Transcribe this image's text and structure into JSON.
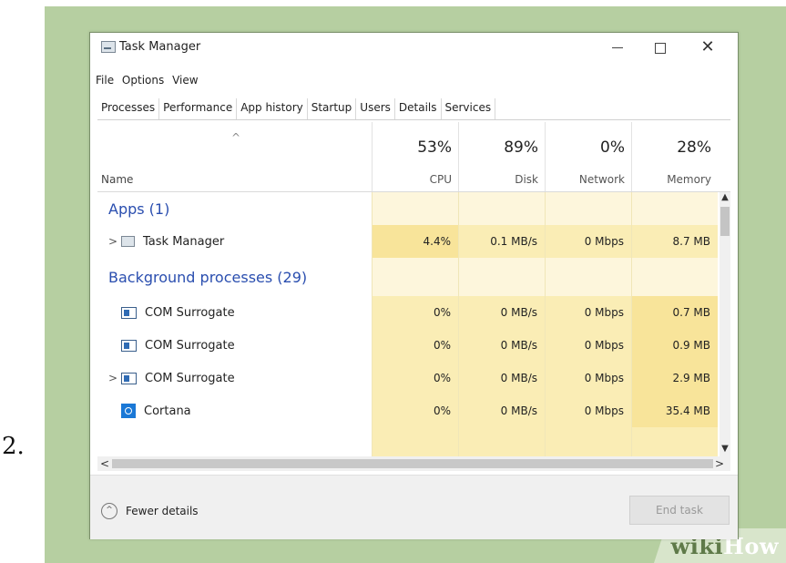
{
  "step_label": "2.",
  "watermark": {
    "wiki": "wiki",
    "how": "How"
  },
  "window": {
    "title": "Task Manager"
  },
  "menu": [
    "File",
    "Options",
    "View"
  ],
  "tabs": [
    "Processes",
    "Performance",
    "App history",
    "Startup",
    "Users",
    "Details",
    "Services"
  ],
  "header": {
    "name_label": "Name",
    "columns": [
      {
        "pct": "53%",
        "label": "CPU"
      },
      {
        "pct": "89%",
        "label": "Disk"
      },
      {
        "pct": "0%",
        "label": "Network"
      },
      {
        "pct": "28%",
        "label": "Memory"
      }
    ]
  },
  "groups": [
    {
      "label": "Apps (1)"
    },
    {
      "label": "Background processes (29)"
    }
  ],
  "rows": [
    {
      "name": "Task Manager",
      "cpu": "4.4%",
      "disk": "0.1 MB/s",
      "network": "0 Mbps",
      "memory": "8.7 MB"
    },
    {
      "name": "COM Surrogate",
      "cpu": "0%",
      "disk": "0 MB/s",
      "network": "0 Mbps",
      "memory": "0.7 MB"
    },
    {
      "name": "COM Surrogate",
      "cpu": "0%",
      "disk": "0 MB/s",
      "network": "0 Mbps",
      "memory": "0.9 MB"
    },
    {
      "name": "COM Surrogate",
      "cpu": "0%",
      "disk": "0 MB/s",
      "network": "0 Mbps",
      "memory": "2.9 MB"
    },
    {
      "name": "Cortana",
      "cpu": "0%",
      "disk": "0 MB/s",
      "network": "0 Mbps",
      "memory": "35.4 MB"
    }
  ],
  "footer": {
    "fewer_details": "Fewer details",
    "end_task": "End task"
  },
  "colors": {
    "heat_light": "#fdf6dc",
    "heat_medium": "#faedb5",
    "heat_strong": "#f8e49a",
    "group_blue": "#2a4eaf"
  }
}
